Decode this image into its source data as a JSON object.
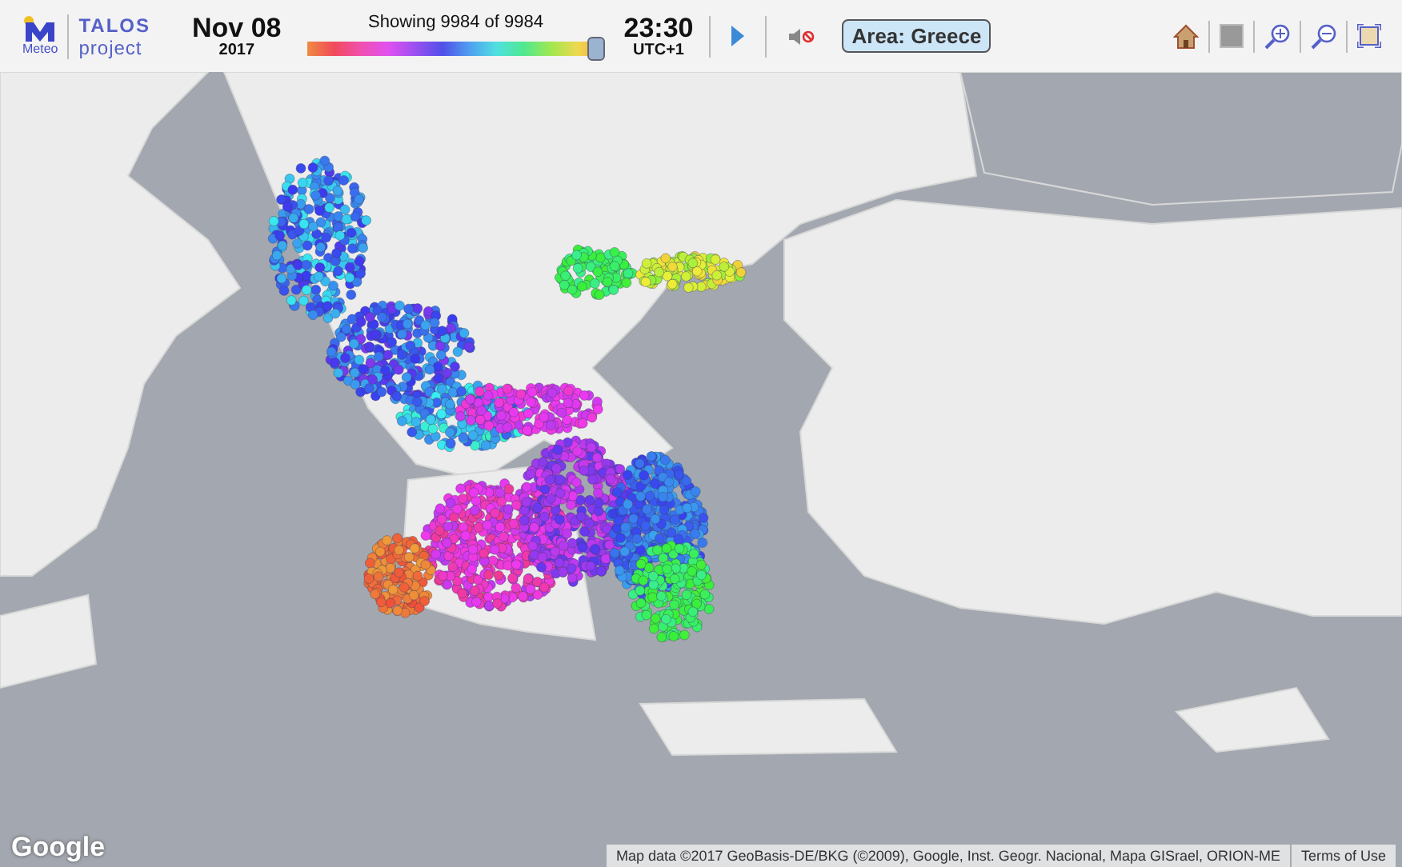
{
  "logo": {
    "brand": "Meteo",
    "title": "TALOS",
    "subtitle": "project"
  },
  "date": {
    "day": "Nov 08",
    "year": "2017"
  },
  "timeline": {
    "caption": "Showing 9984 of 9984",
    "level": 1
  },
  "time": {
    "clock": "23:30",
    "zone": "UTC+1"
  },
  "sound": {
    "muted": true
  },
  "area_button": "Area: Greece",
  "footer": {
    "logo": "Google",
    "attribution": "Map data ©2017 GeoBasis-DE/BKG (©2009), Google, Inst. Geogr. Nacional, Mapa GISrael, ORION-ME",
    "terms": "Terms of Use"
  }
}
